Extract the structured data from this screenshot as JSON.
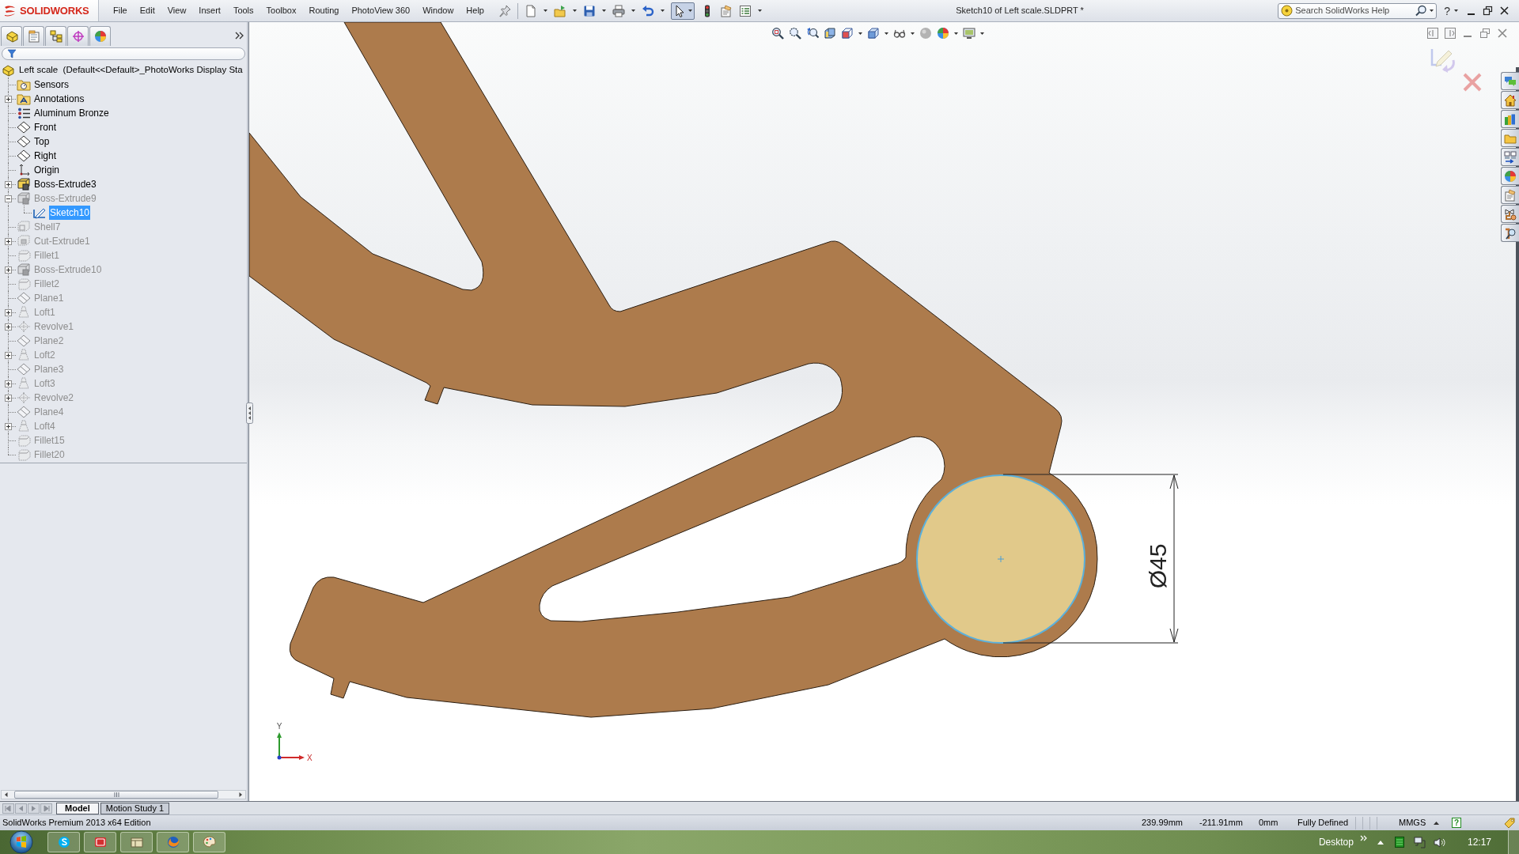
{
  "window": {
    "logo": "SOLIDWORKS",
    "menu": [
      "File",
      "Edit",
      "View",
      "Insert",
      "Tools",
      "Toolbox",
      "Routing",
      "PhotoView 360",
      "Window",
      "Help"
    ],
    "select_tool": {
      "on": true
    },
    "title": "Sketch10 of Left scale.SLDPRT *",
    "search": {
      "placeholder": "Search SolidWorks Help"
    },
    "help": "?"
  },
  "feature_tree": {
    "label": "Left scale  (Default<<Default>_PhotoWorks Display Sta",
    "kind": "part",
    "selected": false,
    "rolled_back": false,
    "children": [
      {
        "label": "Sensors",
        "kind": "sensors",
        "selected": false,
        "rolled_back": false
      },
      {
        "label": "Annotations",
        "kind": "annotations",
        "expanded": false,
        "selected": false,
        "rolled_back": false
      },
      {
        "label": "Aluminum Bronze",
        "kind": "material",
        "selected": false,
        "rolled_back": false
      },
      {
        "label": "Front",
        "kind": "plane",
        "selected": false,
        "rolled_back": false
      },
      {
        "label": "Top",
        "kind": "plane",
        "selected": false,
        "rolled_back": false
      },
      {
        "label": "Right",
        "kind": "plane",
        "selected": false,
        "rolled_back": false
      },
      {
        "label": "Origin",
        "kind": "origin",
        "selected": false,
        "rolled_back": false
      },
      {
        "label": "Boss-Extrude3",
        "kind": "extrude",
        "expanded": false,
        "selected": false,
        "rolled_back": false
      },
      {
        "label": "Boss-Extrude9",
        "kind": "extrude",
        "expanded": true,
        "selected": false,
        "rolled_back": true,
        "children": [
          {
            "label": "Sketch10",
            "kind": "sketch",
            "selected": true,
            "rolled_back": false
          }
        ]
      },
      {
        "label": "Shell7",
        "kind": "shell",
        "selected": false,
        "rolled_back": true
      },
      {
        "label": "Cut-Extrude1",
        "kind": "cut",
        "expanded": false,
        "selected": false,
        "rolled_back": true
      },
      {
        "label": "Fillet1",
        "kind": "fillet",
        "selected": false,
        "rolled_back": true
      },
      {
        "label": "Boss-Extrude10",
        "kind": "extrude",
        "expanded": false,
        "selected": false,
        "rolled_back": true
      },
      {
        "label": "Fillet2",
        "kind": "fillet",
        "selected": false,
        "rolled_back": true
      },
      {
        "label": "Plane1",
        "kind": "plane",
        "selected": false,
        "rolled_back": true
      },
      {
        "label": "Loft1",
        "kind": "loft",
        "expanded": false,
        "selected": false,
        "rolled_back": true
      },
      {
        "label": "Revolve1",
        "kind": "revolve",
        "expanded": false,
        "selected": false,
        "rolled_back": true
      },
      {
        "label": "Plane2",
        "kind": "plane",
        "selected": false,
        "rolled_back": true
      },
      {
        "label": "Loft2",
        "kind": "loft",
        "expanded": false,
        "selected": false,
        "rolled_back": true
      },
      {
        "label": "Plane3",
        "kind": "plane",
        "selected": false,
        "rolled_back": true
      },
      {
        "label": "Loft3",
        "kind": "loft",
        "expanded": false,
        "selected": false,
        "rolled_back": true
      },
      {
        "label": "Revolve2",
        "kind": "revolve",
        "expanded": false,
        "selected": false,
        "rolled_back": true
      },
      {
        "label": "Plane4",
        "kind": "plane",
        "selected": false,
        "rolled_back": true
      },
      {
        "label": "Loft4",
        "kind": "loft",
        "expanded": false,
        "selected": false,
        "rolled_back": true
      },
      {
        "label": "Fillet15",
        "kind": "fillet",
        "selected": false,
        "rolled_back": true
      },
      {
        "label": "Fillet20",
        "kind": "fillet",
        "selected": false,
        "rolled_back": true
      }
    ]
  },
  "graphics": {
    "dimension": "Ø45",
    "triad": {
      "x": "X",
      "y": "Y"
    }
  },
  "bottom_tabs": [
    {
      "label": "Model",
      "selected": true
    },
    {
      "label": "Motion Study 1",
      "selected": false
    }
  ],
  "status_bar": {
    "edition": "SolidWorks Premium 2013 x64 Edition",
    "readouts": [
      "239.99mm",
      "-211.91mm",
      "0mm",
      "Fully Defined"
    ],
    "units": "MMGS",
    "help": "?"
  },
  "taskbar": {
    "toolbar": "Desktop",
    "clock": "12:17"
  }
}
